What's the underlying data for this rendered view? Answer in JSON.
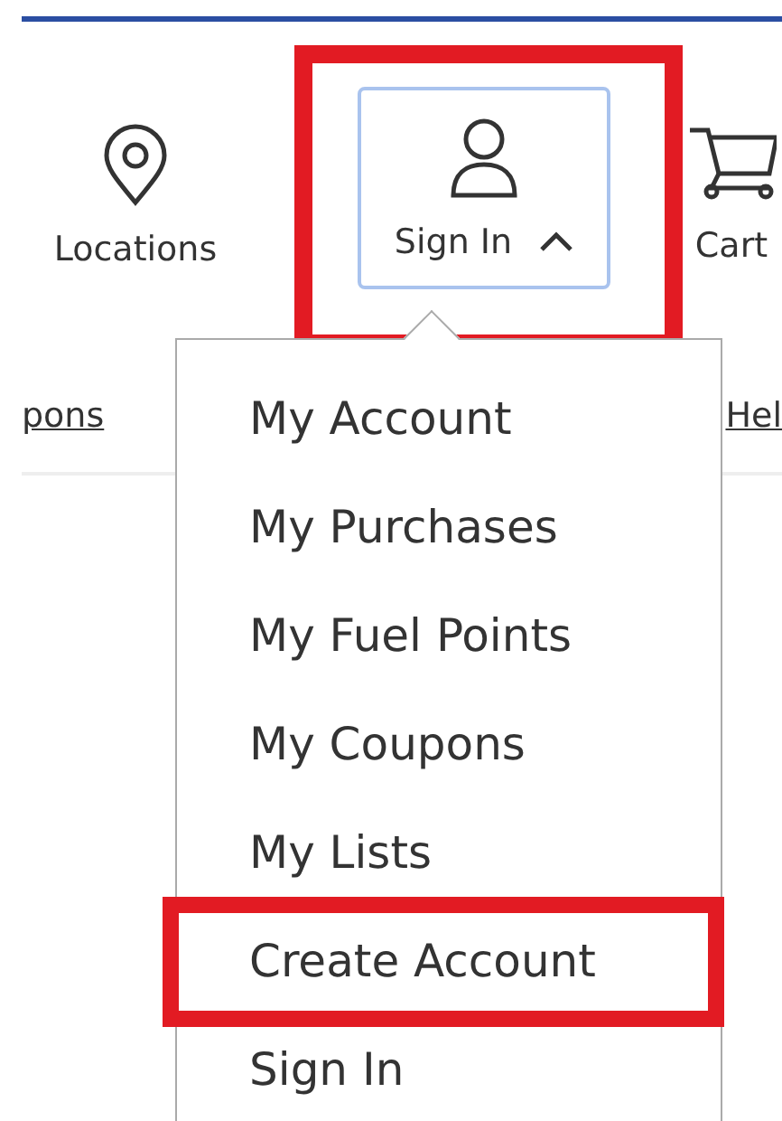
{
  "header": {
    "items": [
      {
        "kind": "location",
        "label": "Locations",
        "highlighted": false
      },
      {
        "kind": "account",
        "label": "Sign In",
        "highlighted": true,
        "expanded": true
      },
      {
        "kind": "cart",
        "label": "Cart",
        "highlighted": false
      }
    ]
  },
  "nav": {
    "left": "pons",
    "right": "Hel"
  },
  "menu": [
    {
      "label": "My Account",
      "highlighted": false
    },
    {
      "label": "My Purchases",
      "highlighted": false
    },
    {
      "label": "My Fuel Points",
      "highlighted": false
    },
    {
      "label": "My Coupons",
      "highlighted": false
    },
    {
      "label": "My Lists",
      "highlighted": false
    },
    {
      "label": "Create Account",
      "highlighted": true
    },
    {
      "label": "Sign In",
      "highlighted": false
    }
  ]
}
